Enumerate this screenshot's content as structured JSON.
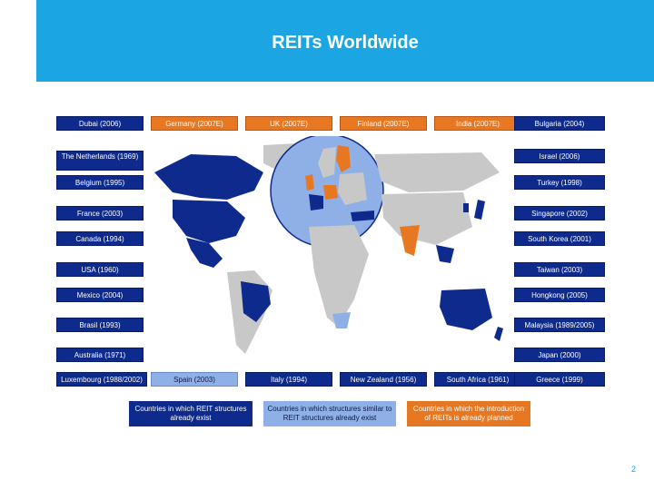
{
  "title": "REITs Worldwide",
  "top_row": {
    "dubai": "Dubai (2006)",
    "germany": "Germany (2007E)",
    "uk": "UK (2007E)",
    "finland": "Finland (2007E)",
    "india": "India (2007E)",
    "bulgaria": "Bulgaria (2004)"
  },
  "left_col": {
    "netherlands": "The Netherlands (1969)",
    "belgium": "Belgium (1995)",
    "france": "France (2003)",
    "canada": "Canada (1994)",
    "usa": "USA (1960)",
    "mexico": "Mexico (2004)",
    "brasil": "Brasil (1993)",
    "australia": "Australia (1971)"
  },
  "right_col": {
    "israel": "Israel (2006)",
    "turkey": "Turkey (1998)",
    "singapore": "Singapore (2002)",
    "south_korea": "South Korea (2001)",
    "taiwan": "Taiwan (2003)",
    "hongkong": "Hongkong (2005)",
    "malaysia": "Malaysia (1989/2005)",
    "japan": "Japan (2000)"
  },
  "bottom_row": {
    "luxembourg": "Luxembourg (1988/2002)",
    "spain": "Spain (2003)",
    "italy": "Italy (1994)",
    "new_zealand": "New Zealand (1956)",
    "south_africa": "South Africa (1961)",
    "greece": "Greece (1999)"
  },
  "legend": {
    "blue": "Countries in which REIT structures already exist",
    "light": "Countries in which structures similar to REIT structures already exist",
    "orange": "Countries in which the introduction of REITs is already planned"
  },
  "page_number": "2",
  "colors": {
    "header": "#1ba6e3",
    "reit_blue": "#0d2a8c",
    "similar_light": "#8fb0e6",
    "planned_orange": "#e87722",
    "map_grey": "#c8c8c8"
  }
}
